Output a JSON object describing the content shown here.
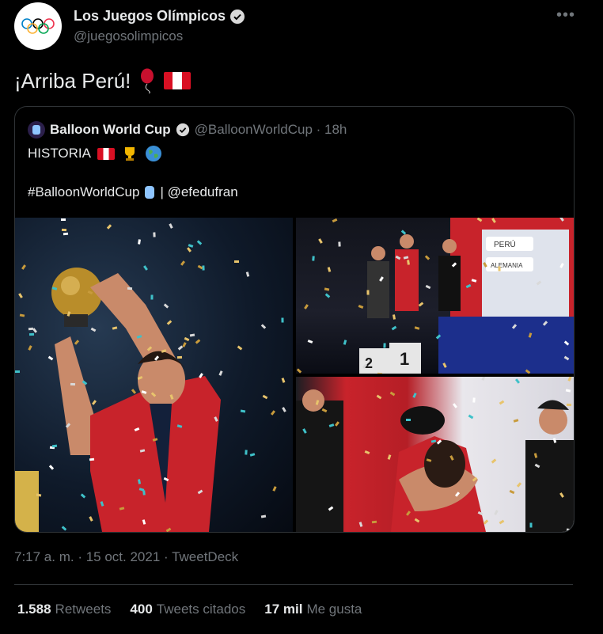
{
  "tweet": {
    "author_name": "Los Juegos Olímpicos",
    "author_handle": "@juegosolimpicos",
    "more_label": "•••",
    "text": "¡Arriba Perú!",
    "meta": "7:17 a. m. · 15 oct. 2021 · TweetDeck"
  },
  "quote": {
    "author_name": "Balloon World Cup",
    "author_handle": "@BalloonWorldCup · 18h",
    "line1": "HISTORIA",
    "hashtag": "#BalloonWorldCup",
    "mention": "| @efedufran"
  },
  "photos": {
    "podium_numbers": [
      "2",
      "1"
    ],
    "podium_banner": "PERÚ",
    "podium_banner2": "ALEMANIA"
  },
  "stats": [
    {
      "count": "1.588",
      "label": "Retweets"
    },
    {
      "count": "400",
      "label": "Tweets citados"
    },
    {
      "count": "17 mil",
      "label": "Me gusta"
    }
  ],
  "colors": {
    "background": "#000000",
    "text": "#e7e9ea",
    "secondary": "#71767b",
    "border": "#2f3336",
    "peru_red": "#d91023"
  }
}
